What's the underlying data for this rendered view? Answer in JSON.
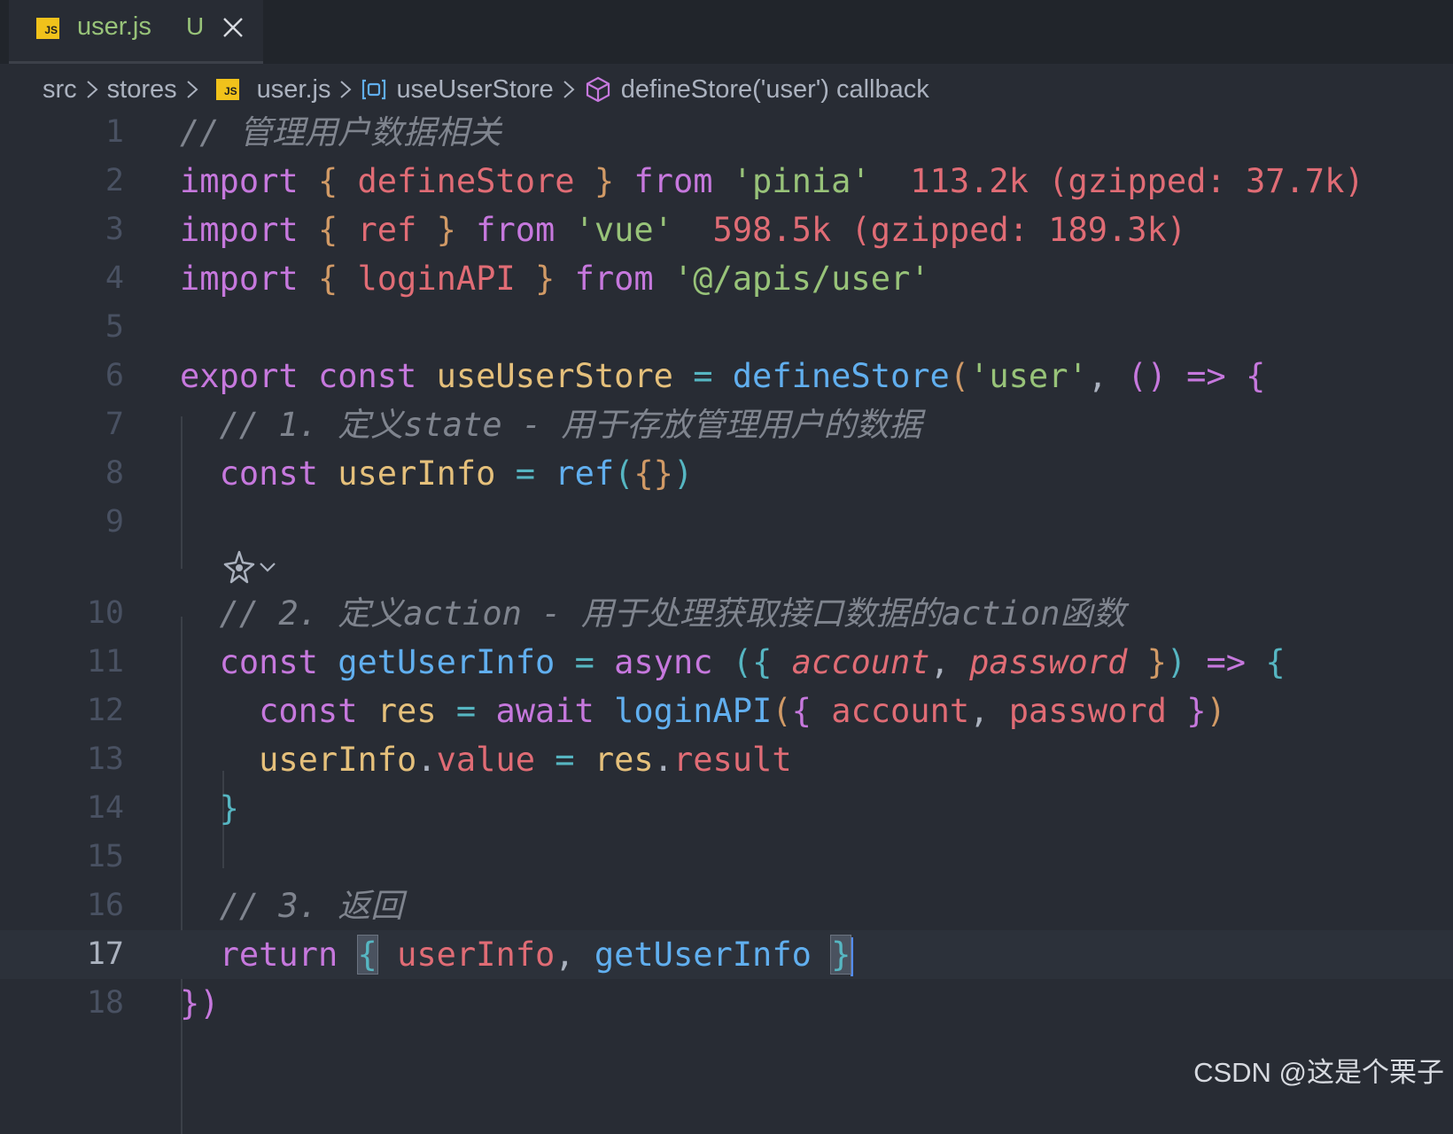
{
  "tab": {
    "filename": "user.js",
    "status": "U",
    "file_icon": "JS"
  },
  "breadcrumb": {
    "items": [
      "src",
      "stores",
      "user.js",
      "useUserStore",
      "defineStore('user') callback"
    ]
  },
  "editor": {
    "line_numbers": [
      "1",
      "2",
      "3",
      "4",
      "5",
      "6",
      "7",
      "8",
      "9",
      "10",
      "11",
      "12",
      "13",
      "14",
      "15",
      "16",
      "17",
      "18"
    ],
    "current_line": "17",
    "code": {
      "l1_comment": "// 管理用户数据相关",
      "l2_import": "import",
      "l2_open": "{",
      "l2_name": "defineStore",
      "l2_close": "}",
      "l2_from": "from",
      "l2_module": "'pinia'",
      "l2_size": "113.2k (gzipped: 37.7k)",
      "l3_import": "import",
      "l3_open": "{",
      "l3_name": "ref",
      "l3_close": "}",
      "l3_from": "from",
      "l3_module": "'vue'",
      "l3_size": "598.5k (gzipped: 189.3k)",
      "l4_import": "import",
      "l4_open": "{",
      "l4_name": "loginAPI",
      "l4_close": "}",
      "l4_from": "from",
      "l4_module": "'@/apis/user'",
      "l6_export": "export",
      "l6_const": "const",
      "l6_name": "useUserStore",
      "l6_eq": "=",
      "l6_fn": "defineStore",
      "l6_paren": "(",
      "l6_str": "'user'",
      "l6_comma": ",",
      "l6_args": "()",
      "l6_arrow": "=>",
      "l6_brace": "{",
      "l7_comment": "// 1. 定义state - 用于存放管理用户的数据",
      "l8_const": "const",
      "l8_name": "userInfo",
      "l8_eq": "=",
      "l8_fn": "ref",
      "l8_open": "(",
      "l8_obj": "{}",
      "l8_close": ")",
      "l10_comment": "// 2. 定义action - 用于处理获取接口数据的action函数",
      "l11_const": "const",
      "l11_name": "getUserInfo",
      "l11_eq": "=",
      "l11_async": "async",
      "l11_open": "({",
      "l11_p1": "account",
      "l11_comma": ",",
      "l11_p2": "password",
      "l11_close1": "}",
      "l11_close2": ")",
      "l11_arrow": "=>",
      "l11_brace": "{",
      "l12_const": "const",
      "l12_name": "res",
      "l12_eq": "=",
      "l12_await": "await",
      "l12_fn": "loginAPI",
      "l12_open1": "(",
      "l12_open2": "{",
      "l12_p1": "account",
      "l12_comma": ",",
      "l12_p2": "password",
      "l12_close1": "}",
      "l12_close2": ")",
      "l13_obj": "userInfo",
      "l13_dot": ".",
      "l13_prop": "value",
      "l13_eq": "=",
      "l13_res": "res",
      "l13_dot2": ".",
      "l13_result": "result",
      "l14_brace": "}",
      "l16_comment": "// 3. 返回",
      "l17_return": "return",
      "l17_open": "{",
      "l17_a": "userInfo",
      "l17_comma": ",",
      "l17_b": "getUserInfo",
      "l17_close": "}",
      "l18_close": "})"
    }
  },
  "watermark": "CSDN @这是个栗子",
  "colors": {
    "background": "#282c34",
    "keyword": "#c678dd",
    "function": "#61afef",
    "string": "#98c379",
    "variable": "#e06c75",
    "comment": "#7f848e",
    "import_size": "#e06c75",
    "tab_modified": "#98c379"
  },
  "icons": [
    "js-file-icon",
    "close-icon",
    "chevron-right-icon",
    "module-icon",
    "cube-icon",
    "ai-sparkle-icon",
    "chevron-down-icon"
  ]
}
